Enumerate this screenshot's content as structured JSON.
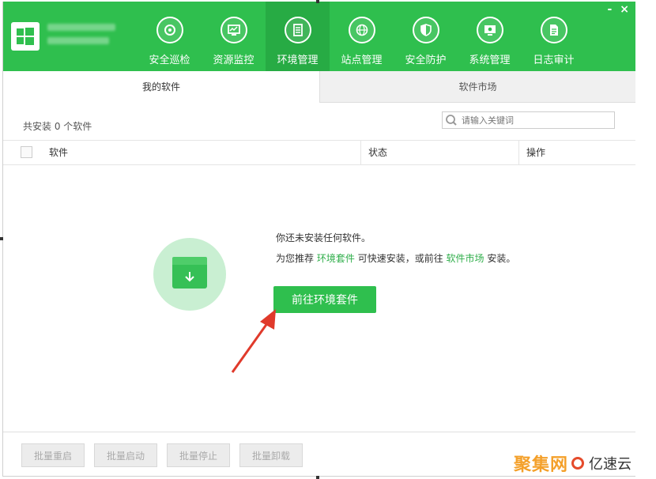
{
  "nav": {
    "items": [
      {
        "label": "安全巡检",
        "icon": "radar-icon"
      },
      {
        "label": "资源监控",
        "icon": "monitor-chart-icon"
      },
      {
        "label": "环境管理",
        "icon": "server-icon",
        "active": true
      },
      {
        "label": "站点管理",
        "icon": "globe-icon"
      },
      {
        "label": "安全防护",
        "icon": "shield-icon"
      },
      {
        "label": "系统管理",
        "icon": "settings-monitor-icon"
      },
      {
        "label": "日志审计",
        "icon": "document-icon"
      }
    ]
  },
  "window_controls": {
    "minimize": "-",
    "close": "×"
  },
  "tabs": {
    "my_software": "我的软件",
    "market": "软件市场"
  },
  "count_label": "共安装 0 个软件",
  "search": {
    "placeholder": "请输入关键词"
  },
  "table": {
    "col_software": "软件",
    "col_status": "状态",
    "col_action": "操作"
  },
  "empty": {
    "line1": "你还未安装任何软件。",
    "line2_prefix": "为您推荐",
    "link1": "环境套件",
    "line2_mid": "可快速安装，或前往",
    "link2": "软件市场",
    "line2_suffix": "安装。",
    "button": "前往环境套件"
  },
  "footer": {
    "restart": "批量重启",
    "start": "批量启动",
    "stop": "批量停止",
    "uninstall": "批量卸载"
  },
  "watermark": {
    "text1": "聚集网",
    "text2": "亿速云"
  },
  "colors": {
    "brand": "#2fbf4e",
    "arrow": "#e03a2b",
    "watermark": "#f4a02a"
  }
}
